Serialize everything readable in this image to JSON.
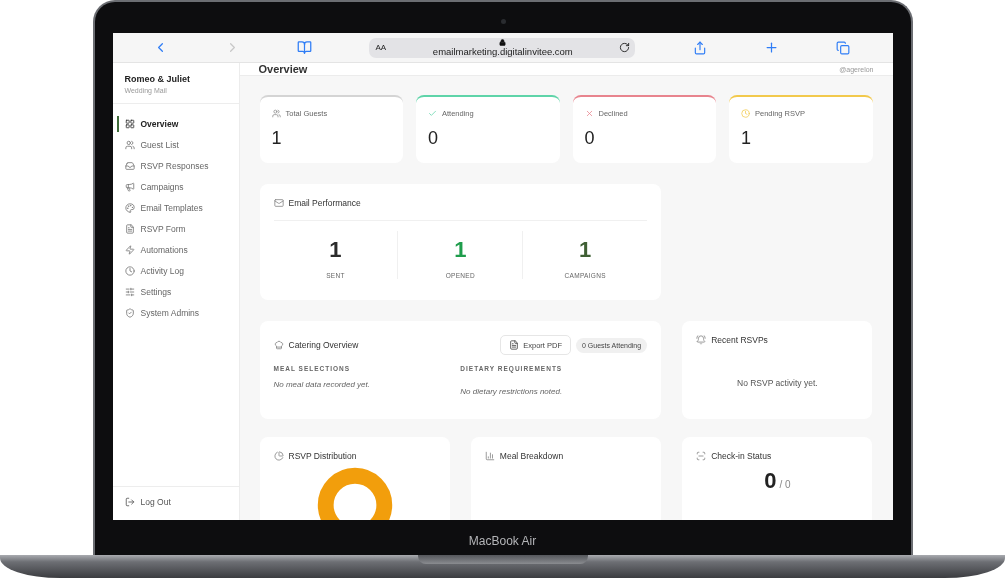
{
  "device": {
    "label": "MacBook Air"
  },
  "browser": {
    "text_size": "AA",
    "url": "emailmarketing.digitalinvitee.com"
  },
  "sidebar": {
    "title": "Romeo & Juliet",
    "subtitle": "Wedding Mail",
    "items": [
      {
        "label": "Overview",
        "selected": true
      },
      {
        "label": "Guest List",
        "selected": false
      },
      {
        "label": "RSVP Responses",
        "selected": false
      },
      {
        "label": "Campaigns",
        "selected": false
      },
      {
        "label": "Email Templates",
        "selected": false
      },
      {
        "label": "RSVP Form",
        "selected": false
      },
      {
        "label": "Automations",
        "selected": false
      },
      {
        "label": "Activity Log",
        "selected": false
      },
      {
        "label": "Settings",
        "selected": false
      },
      {
        "label": "System Admins",
        "selected": false
      }
    ],
    "logout": "Log Out"
  },
  "header": {
    "title": "Overview",
    "user": "@agerelon"
  },
  "stats": [
    {
      "label": "Total Guests",
      "value": "1",
      "color": "#d4d4d4"
    },
    {
      "label": "Attending",
      "value": "0",
      "color": "#5fd4a9"
    },
    {
      "label": "Declined",
      "value": "0",
      "color": "#e8848e"
    },
    {
      "label": "Pending RSVP",
      "value": "1",
      "color": "#f2c94c"
    }
  ],
  "email_performance": {
    "title": "Email Performance",
    "metrics": [
      {
        "value": "1",
        "label": "SENT",
        "color": "#2b2b2b"
      },
      {
        "value": "1",
        "label": "OPENED",
        "color": "#1f9d4c"
      },
      {
        "value": "1",
        "label": "CAMPAIGNS",
        "color": "#3f5f34"
      }
    ]
  },
  "catering": {
    "title": "Catering Overview",
    "export": "Export PDF",
    "badge": "0 Guests Attending",
    "sections": [
      {
        "heading": "MEAL SELECTIONS",
        "note": "No meal data recorded yet."
      },
      {
        "heading": "DIETARY REQUIREMENTS",
        "note": "No dietary restrictions noted."
      }
    ]
  },
  "recent_rsvps": {
    "title": "Recent RSVPs",
    "empty": "No RSVP activity yet."
  },
  "rsvp_distribution": {
    "title": "RSVP Distribution"
  },
  "meal_breakdown": {
    "title": "Meal Breakdown"
  },
  "checkin": {
    "title": "Check-in Status",
    "count": "0",
    "total": "/ 0"
  }
}
